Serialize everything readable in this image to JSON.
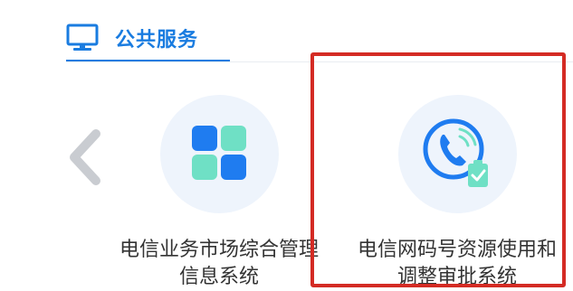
{
  "section": {
    "title": "公共服务",
    "icon": "monitor-icon",
    "accent_color": "#1a7ce0"
  },
  "carousel": {
    "prev_icon": "chevron-left-icon"
  },
  "services": [
    {
      "icon": "grid-apps-icon",
      "label_line1": "电信业务市场综合管理",
      "label_line2": "信息系统"
    },
    {
      "icon": "phone-check-icon",
      "label_line1": "电信网码号资源使用和",
      "label_line2": "调整审批系统"
    }
  ],
  "highlight": {
    "color": "#d42b24"
  }
}
